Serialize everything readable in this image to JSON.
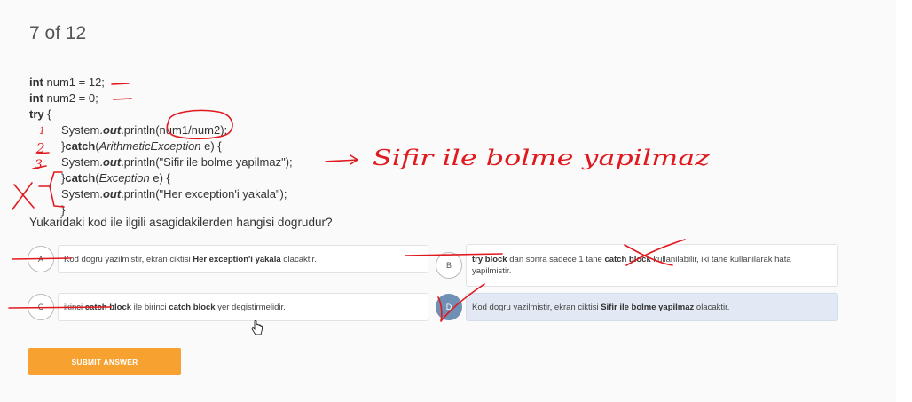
{
  "header": {
    "counter": "7 of 12"
  },
  "code": {
    "line1": {
      "kw": "int",
      "rest": " num1 = 12;"
    },
    "line2": {
      "kw": "int",
      "rest": " num2 = 0;"
    },
    "line3": {
      "kw": "try",
      "rest": " {"
    },
    "line4": {
      "pre": "System.",
      "out": "out",
      "mid": ".println(",
      "arg": "num1/num2",
      "end": ");"
    },
    "line5": {
      "pre": "}",
      "kw": "catch",
      "open": "(",
      "type": "ArithmeticException",
      "end": " e) {"
    },
    "line6": {
      "pre": "System.",
      "out": "out",
      "end": ".println(\"Sifir ile bolme yapilmaz\");"
    },
    "line7": {
      "pre": "}",
      "kw": "catch",
      "open": "(",
      "type": "Exception",
      "end": " e) {"
    },
    "line8": {
      "pre": "System.",
      "out": "out",
      "end": ".println(\"Her exception'i yakala\");"
    },
    "line9": "}"
  },
  "question": "Yukaridaki kod ile ilgili asagidakilerden hangisi dogrudur?",
  "options": {
    "a": {
      "letter": "A",
      "t1": "Kod dogru yazilmistir, ekran ciktisi ",
      "b1": "Her exception'i yakala",
      "t2": " olacaktir."
    },
    "b": {
      "letter": "B",
      "b1": "try block",
      "t1": " dan sonra sadece 1 tane ",
      "b2": "catch block",
      "t2": " kullanilabilir, iki tane kullanilarak hata yapilmistir."
    },
    "c": {
      "letter": "C",
      "t1": "ikinci ",
      "b1": "catch block",
      "t2": " ile birinci ",
      "b2": "catch block",
      "t3": " yer degistirmelidir."
    },
    "d": {
      "letter": "D",
      "t1": "Kod dogru yazilmistir, ekran ciktisi ",
      "b1": "Sifir ile bolme yapilmaz",
      "t2": " olacaktir.",
      "selected": true
    }
  },
  "submit_label": "SUBMIT ANSWER",
  "annotations": {
    "handwritten_note": "Sifir ile bolme yapilmaz",
    "numbers": [
      "1",
      "2",
      "3"
    ]
  },
  "colors": {
    "accent": "#f7a230",
    "selected": "#e2e8f4",
    "ink": "#e0191f"
  }
}
